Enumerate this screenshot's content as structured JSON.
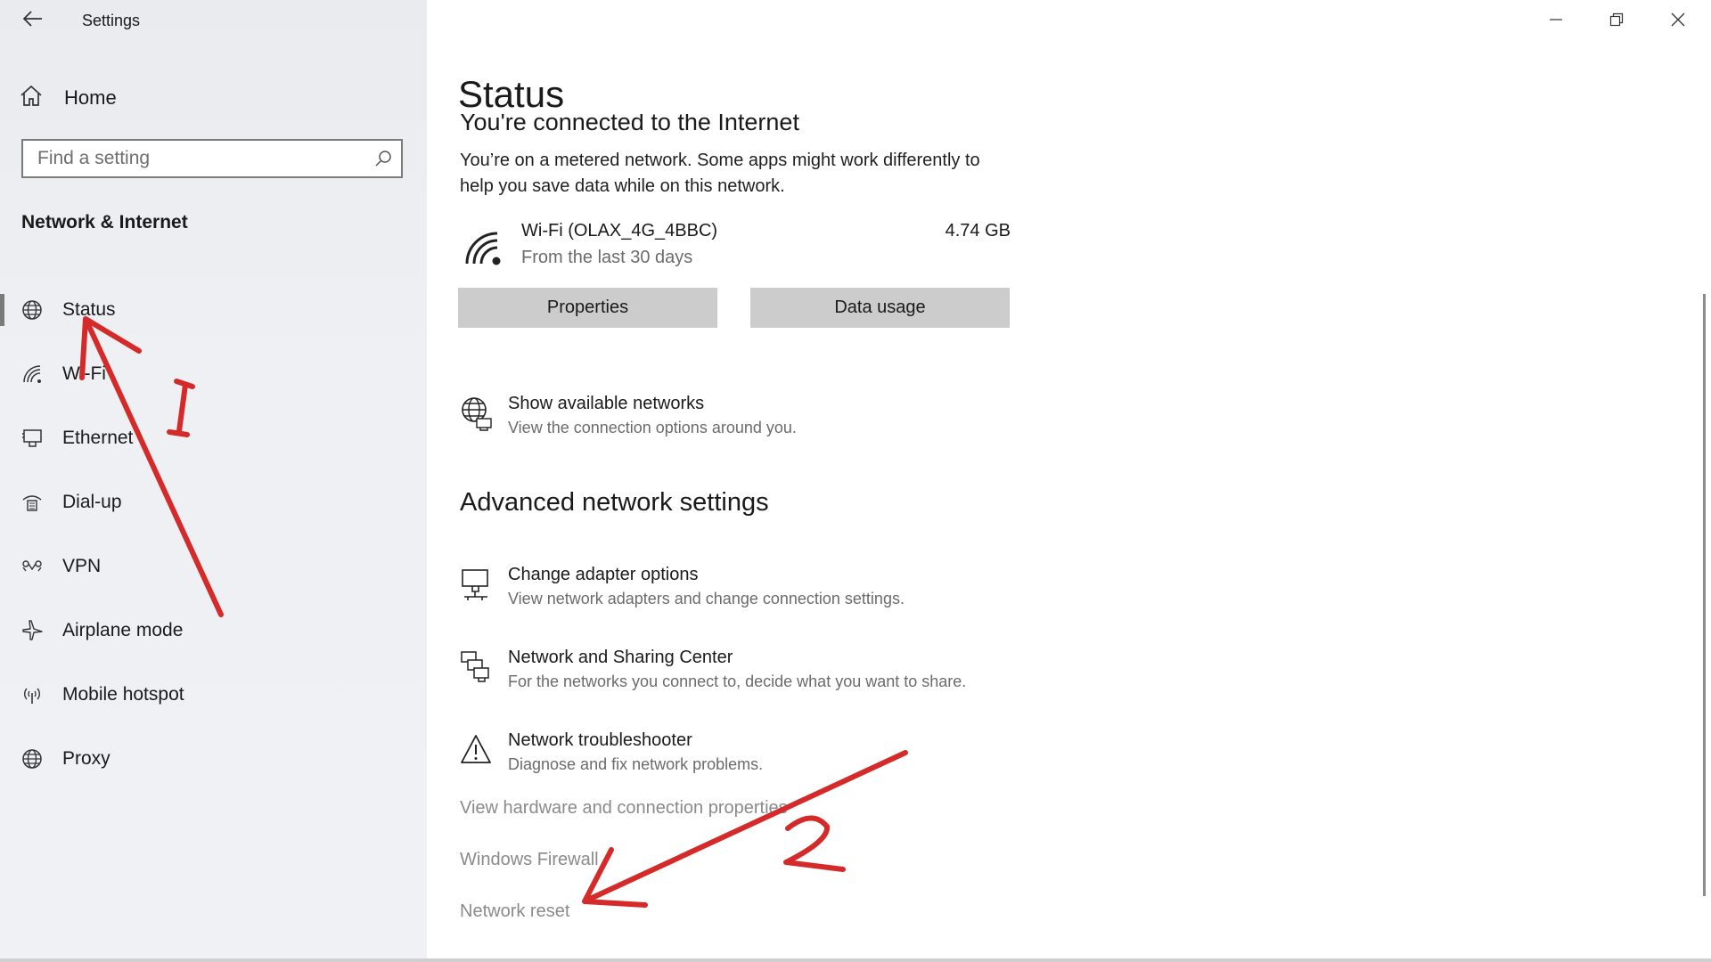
{
  "window": {
    "title": "Settings",
    "controls": [
      "minimize",
      "restore",
      "close"
    ]
  },
  "sidebar": {
    "home_label": "Home",
    "search_placeholder": "Find a setting",
    "section_title": "Network & Internet",
    "items": [
      {
        "label": "Status",
        "icon": "status-globe-icon",
        "active": true
      },
      {
        "label": "Wi-Fi",
        "icon": "wifi-icon",
        "active": false
      },
      {
        "label": "Ethernet",
        "icon": "ethernet-icon",
        "active": false
      },
      {
        "label": "Dial-up",
        "icon": "dialup-icon",
        "active": false
      },
      {
        "label": "VPN",
        "icon": "vpn-icon",
        "active": false
      },
      {
        "label": "Airplane mode",
        "icon": "airplane-icon",
        "active": false
      },
      {
        "label": "Mobile hotspot",
        "icon": "hotspot-icon",
        "active": false
      },
      {
        "label": "Proxy",
        "icon": "globe-icon",
        "active": false
      }
    ]
  },
  "main": {
    "title": "Status",
    "connected_header": "You're connected to the Internet",
    "metered_text": "You’re on a metered network. Some apps might work differently to help you save data while on this network.",
    "connection": {
      "name": "Wi-Fi (OLAX_4G_4BBC)",
      "period": "From the last 30 days",
      "usage": "4.74 GB"
    },
    "buttons": {
      "properties": "Properties",
      "data_usage": "Data usage"
    },
    "show_networks": {
      "title": "Show available networks",
      "subtitle": "View the connection options around you."
    },
    "advanced_title": "Advanced network settings",
    "advanced_items": [
      {
        "title": "Change adapter options",
        "subtitle": "View network adapters and change connection settings.",
        "icon": "adapter-icon"
      },
      {
        "title": "Network and Sharing Center",
        "subtitle": "For the networks you connect to, decide what you want to share.",
        "icon": "sharing-center-icon"
      },
      {
        "title": "Network troubleshooter",
        "subtitle": "Diagnose and fix network problems.",
        "icon": "warning-icon"
      }
    ],
    "links": [
      "View hardware and connection properties",
      "Windows Firewall",
      "Network reset"
    ]
  },
  "annotations": {
    "color": "#d42a2a",
    "marks": [
      "1",
      "2"
    ]
  }
}
